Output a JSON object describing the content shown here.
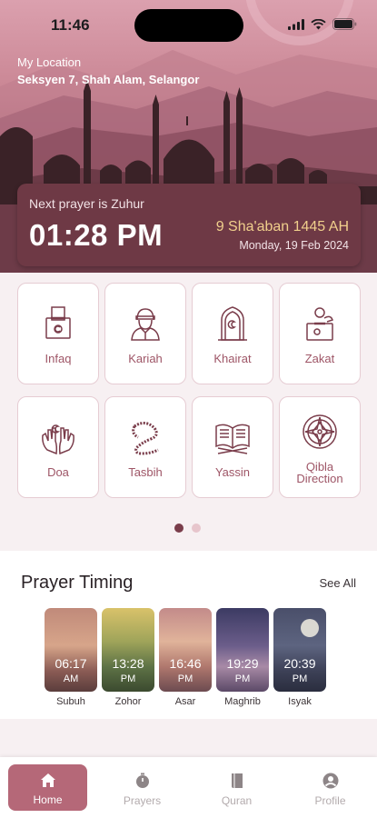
{
  "status_bar": {
    "time": "11:46"
  },
  "location": {
    "label": "My Location",
    "value": "Seksyen 7, Shah Alam, Selangor"
  },
  "next_prayer": {
    "label": "Next prayer is Zuhur",
    "time": "01:28 PM",
    "hijri_date": "9 Sha'aban 1445 AH",
    "gregorian_date": "Monday, 19 Feb 2024"
  },
  "features": [
    {
      "label": "Infaq",
      "icon": "donation-box-icon"
    },
    {
      "label": "Kariah",
      "icon": "person-icon"
    },
    {
      "label": "Khairat",
      "icon": "mosque-door-icon"
    },
    {
      "label": "Zakat",
      "icon": "zakat-box-icon"
    },
    {
      "label": "Doa",
      "icon": "praying-hands-icon"
    },
    {
      "label": "Tasbih",
      "icon": "prayer-beads-icon"
    },
    {
      "label": "Yassin",
      "icon": "quran-icon"
    },
    {
      "label": "Qibla\nDirection",
      "icon": "compass-icon"
    }
  ],
  "pager": {
    "pages": 2,
    "active": 1
  },
  "prayer_timing": {
    "title": "Prayer Timing",
    "see_all": "See All",
    "items": [
      {
        "name": "Subuh",
        "time": "06:17",
        "ampm": "AM"
      },
      {
        "name": "Zohor",
        "time": "13:28",
        "ampm": "PM"
      },
      {
        "name": "Asar",
        "time": "16:46",
        "ampm": "PM"
      },
      {
        "name": "Maghrib",
        "time": "19:29",
        "ampm": "PM"
      },
      {
        "name": "Isyak",
        "time": "20:39",
        "ampm": "PM"
      }
    ]
  },
  "bottom_nav": [
    {
      "label": "Home",
      "icon": "home-icon",
      "active": true
    },
    {
      "label": "Prayers",
      "icon": "stopwatch-icon",
      "active": false
    },
    {
      "label": "Quran",
      "icon": "book-icon",
      "active": false
    },
    {
      "label": "Profile",
      "icon": "profile-icon",
      "active": false
    }
  ],
  "colors": {
    "accent": "#6e3945",
    "nav_active": "#b56878",
    "label": "#9e5566",
    "gold": "#f0cf8c"
  }
}
